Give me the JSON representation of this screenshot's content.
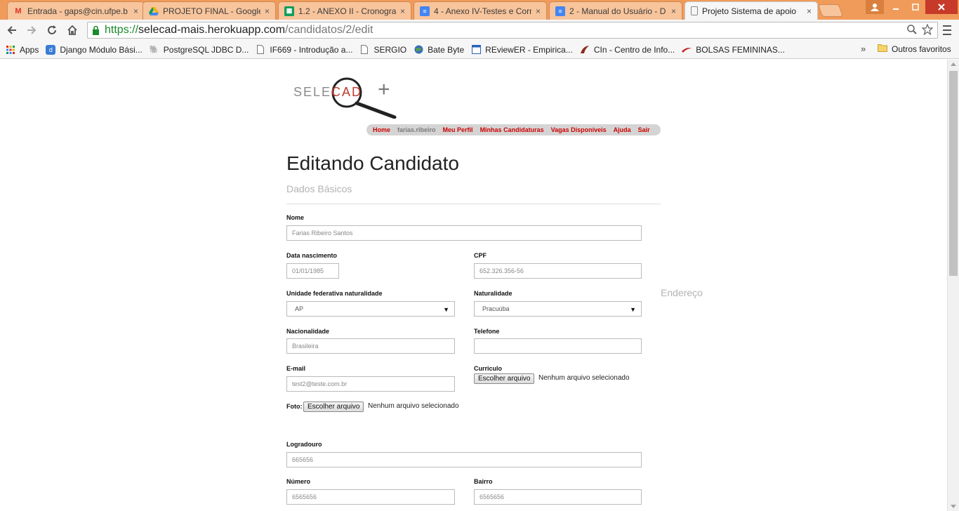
{
  "browser": {
    "tabs": [
      {
        "title": "Entrada - gaps@cin.ufpe.b",
        "icon": "gmail-icon"
      },
      {
        "title": "PROJETO FINAL - Google",
        "icon": "drive-icon"
      },
      {
        "title": "1.2 - ANEXO II - Cronogra",
        "icon": "sheets-icon"
      },
      {
        "title": "4 - Anexo IV-Testes e Corr",
        "icon": "docs-icon"
      },
      {
        "title": "2 - Manual do Usuário - D",
        "icon": "docs-icon"
      },
      {
        "title": "Projeto Sistema de apoio",
        "icon": "page-icon"
      }
    ],
    "close_glyph": "×",
    "url": {
      "scheme": "https://",
      "host": "selecad-mais.herokuapp.com",
      "path": "/candidatos/2/edit"
    },
    "bookmarks": [
      {
        "label": "Apps",
        "icon": "apps-grid-icon"
      },
      {
        "label": "Django Módulo Bási...",
        "icon": "django-icon"
      },
      {
        "label": "PostgreSQL JDBC D...",
        "icon": "postgres-icon"
      },
      {
        "label": "IF669 - Introdução a...",
        "icon": "page-icon"
      },
      {
        "label": "SERGIO",
        "icon": "page-icon"
      },
      {
        "label": "Bate Byte",
        "icon": "globe-icon"
      },
      {
        "label": "REviewER - Empirica...",
        "icon": "reviewer-icon"
      },
      {
        "label": "CIn - Centro de Info...",
        "icon": "cin-icon"
      },
      {
        "label": "BOLSAS FEMININAS...",
        "icon": "bolsas-icon"
      }
    ],
    "bookmarks_more": "»",
    "other_bookmarks": "Outros favoritos"
  },
  "site": {
    "logo": {
      "prefix": "SELE",
      "highlight": "CAD",
      "suffix": "+"
    },
    "nav": {
      "home": "Home",
      "user": "farias.ribeiro",
      "profile": "Meu Perfil",
      "applications": "Minhas Candidaturas",
      "vacancies": "Vagas Disponíveis",
      "help": "Ajuda",
      "logout": "Sair"
    }
  },
  "form": {
    "title": "Editando Candidato",
    "section_basic": "Dados Básicos",
    "section_address": "Endereço",
    "fields": {
      "nome": {
        "label": "Nome",
        "value": "Farias Ribeiro Santos"
      },
      "data_nascimento": {
        "label": "Data nascimento",
        "value": "01/01/1985"
      },
      "cpf": {
        "label": "CPF",
        "value": "652.326.356-56"
      },
      "uf": {
        "label": "Unidade federativa naturalidade",
        "value": "AP"
      },
      "naturalidade": {
        "label": "Naturalidade",
        "value": "Pracuúba"
      },
      "nacionalidade": {
        "label": "Nacionalidade",
        "value": "Brasileira"
      },
      "telefone": {
        "label": "Telefone",
        "value": ""
      },
      "email": {
        "label": "E-mail",
        "value": "test2@teste.com.br"
      },
      "curriculo": {
        "label": "Curriculo",
        "button": "Escolher arquivo",
        "status": "Nenhum arquivo selecionado"
      },
      "foto": {
        "label": "Foto:",
        "button": "Escolher arquivo",
        "status": "Nenhum arquivo selecionado"
      },
      "logradouro": {
        "label": "Logradouro",
        "value": "665656"
      },
      "numero": {
        "label": "Número",
        "value": "6565656"
      },
      "bairro": {
        "label": "Bairro",
        "value": "6565656"
      }
    },
    "select_arrow": "▼"
  }
}
